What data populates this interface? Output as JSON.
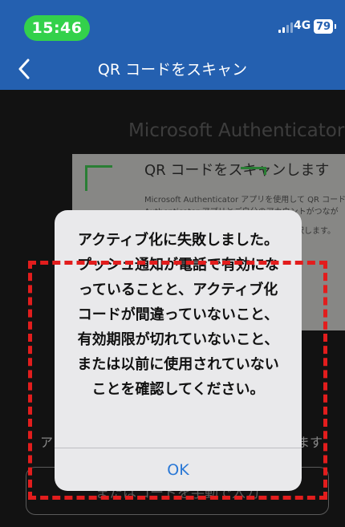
{
  "status_bar": {
    "time": "15:46",
    "network": "4G",
    "battery": "79"
  },
  "nav": {
    "title": "QR コードをスキャン",
    "back_icon": "chevron-left-icon"
  },
  "camera_view": {
    "heading": "Microsoft Authenticator",
    "paper_title": "QR コードをスキャンします",
    "paper_line1": "Microsoft Authenticator アプリを使用して QR コード",
    "paper_line2": "Authenticator アプリとご自分のアカウントがつなが",
    "paper_line3": "QR コードをスキャンした後、[次へ] を選択します。",
    "side_text_left": "アカ",
    "side_text_right": "ます",
    "manual_button": "またはコードを手動で入力"
  },
  "alert": {
    "lines": [
      "アクティブ化に失敗しました。",
      "プッシュ通知が電話で有効にな",
      "っていることと、アクティブ化",
      "コードが間違っていないこと、",
      "有効期限が切れていないこと、",
      "または以前に使用されていない",
      "ことを確認してください。"
    ],
    "ok_label": "OK"
  },
  "colors": {
    "header_blue": "#2460b0",
    "time_green": "#33d14b",
    "scan_bracket": "#3fc250",
    "ios_link_blue": "#2a78d6",
    "annotation_red": "#e21d1d"
  }
}
